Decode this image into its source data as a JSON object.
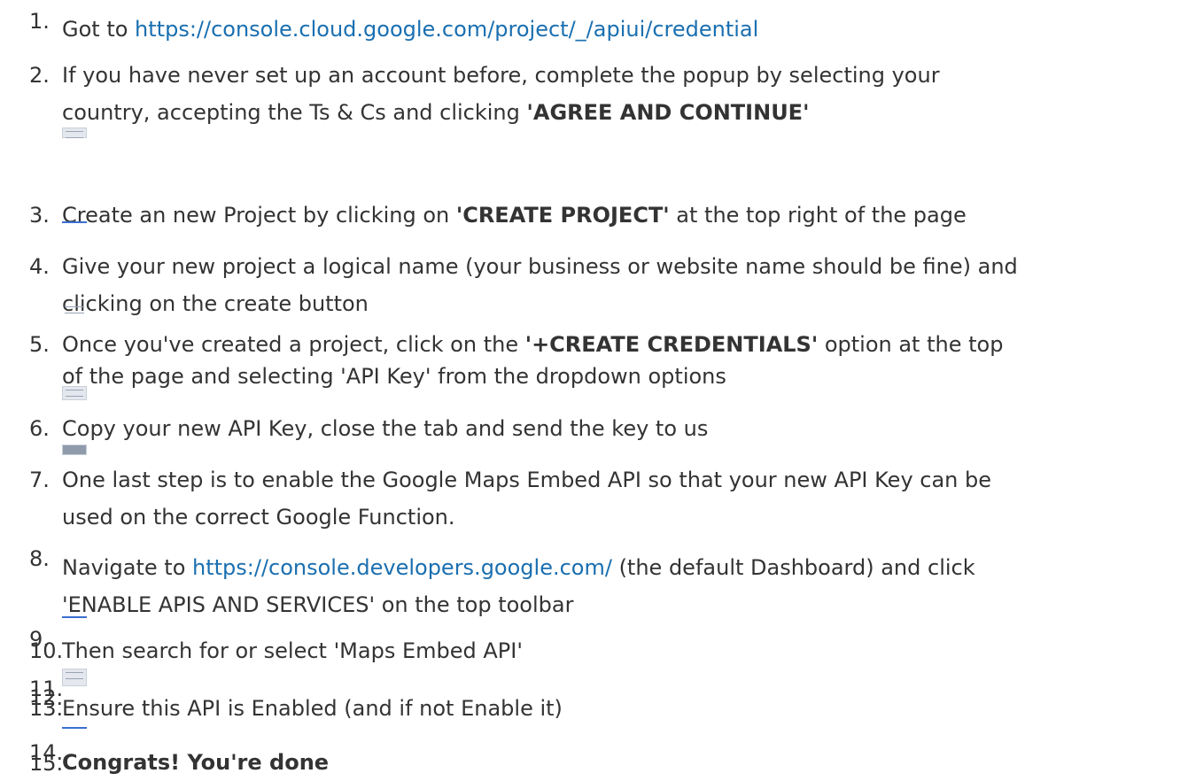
{
  "steps": [
    {
      "num": "1.",
      "prefix": "Got to ",
      "link": "https://console.cloud.google.com/project/_/apiui/credential"
    },
    {
      "num": "2.",
      "line1": "If you have never set up an account before, complete the popup by selecting your",
      "line2_pre": "country, accepting the Ts & Cs and clicking ",
      "line2_bold": "'AGREE AND CONTINUE'"
    },
    {
      "num": "3.",
      "pre": "Create an new Project by clicking on ",
      "bold": "'CREATE PROJECT'",
      "post": " at the top right of the page"
    },
    {
      "num": "4.",
      "line1": "Give your new project a logical name (your business or website name should be fine) and",
      "line2": "clicking on the create button"
    },
    {
      "num": "5.",
      "pre": "Once you've created a project, click on the ",
      "bold": "'+CREATE CREDENTIALS'",
      "post": " option at the top",
      "line2": "of the page and selecting 'API Key' from the dropdown options"
    },
    {
      "num": "6.",
      "text": "Copy your new API Key, close the tab and send the key to us"
    },
    {
      "num": "7.",
      "line1": "One last step is to enable the Google Maps Embed API so that your new API Key can be",
      "line2": "used on the correct Google Function."
    },
    {
      "num": "8.",
      "prefix": "Navigate to ",
      "link": "https://console.developers.google.com/",
      "post": " (the default Dashboard) and click",
      "line2": "'ENABLE APIS AND SERVICES' on the top toolbar"
    },
    {
      "num_a": "9.",
      "num_b": "10.",
      "text": "Then search for or select 'Maps Embed API'"
    },
    {
      "num_a": "11.",
      "num_b": "12.",
      "num_c": "13.",
      "text": "Ensure this API is Enabled (and if not Enable it)"
    },
    {
      "num_a": "14.",
      "num_b": "15.",
      "bold": "Congrats! You're done"
    }
  ]
}
